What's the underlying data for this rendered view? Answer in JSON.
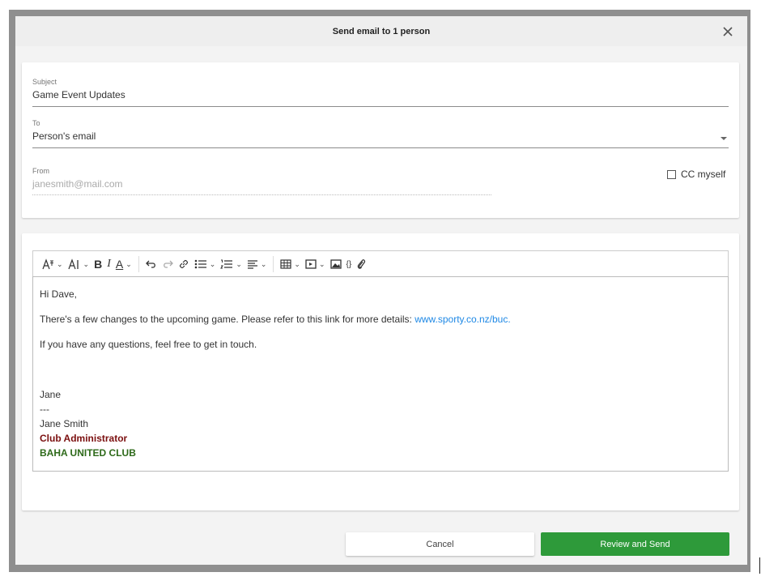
{
  "dialog": {
    "title": "Send email to 1 person",
    "close_icon": "close-icon"
  },
  "fields": {
    "subject": {
      "label": "Subject",
      "value": "Game Event Updates"
    },
    "to": {
      "label": "To",
      "value": "Person's email",
      "icon": "chevron-down-icon"
    },
    "from": {
      "label": "From",
      "value": "janesmith@mail.com"
    },
    "cc_myself": {
      "label": "CC myself",
      "checked": false
    }
  },
  "toolbar": {
    "buttons": [
      {
        "name": "font-family",
        "icon": "font-family-icon",
        "dropdown": true
      },
      {
        "name": "font-size",
        "icon": "font-size-icon",
        "dropdown": true
      },
      {
        "name": "bold",
        "glyph": "B",
        "icon": "bold-icon"
      },
      {
        "name": "italic",
        "glyph": "I",
        "icon": "italic-icon"
      },
      {
        "name": "text-color",
        "glyph": "A",
        "icon": "text-color-icon",
        "dropdown": true
      },
      {
        "name": "undo",
        "icon": "undo-icon"
      },
      {
        "name": "redo",
        "icon": "redo-icon"
      },
      {
        "name": "link",
        "icon": "link-icon"
      },
      {
        "name": "bullet-list",
        "icon": "bullet-list-icon",
        "dropdown": true
      },
      {
        "name": "numbered-list",
        "icon": "numbered-list-icon",
        "dropdown": true
      },
      {
        "name": "align",
        "icon": "align-left-icon",
        "dropdown": true
      },
      {
        "name": "table",
        "icon": "table-icon",
        "dropdown": true
      },
      {
        "name": "media",
        "icon": "video-icon",
        "dropdown": true
      },
      {
        "name": "image",
        "icon": "image-icon"
      },
      {
        "name": "code",
        "glyph": "{}",
        "icon": "code-icon"
      },
      {
        "name": "attachment",
        "icon": "paperclip-icon"
      }
    ]
  },
  "body": {
    "greeting": "Hi Dave,",
    "line1_text": "There's a few changes to the upcoming game. Please refer to this link for more details: ",
    "line1_link": "www.sporty.co.nz/buc.",
    "line2": "If you have any questions, feel free to get in touch.",
    "signoff": "Jane",
    "separator": "---",
    "sig_name": "Jane Smith",
    "sig_title": "Club Administrator",
    "sig_club": "BAHA UNITED CLUB"
  },
  "colors": {
    "link": "#1e88e5",
    "sig_title": "#7b0f0f",
    "sig_club": "#2e6a1a",
    "primary_button": "#2e9a3a"
  },
  "actions": {
    "cancel": "Cancel",
    "send": "Review and Send"
  }
}
